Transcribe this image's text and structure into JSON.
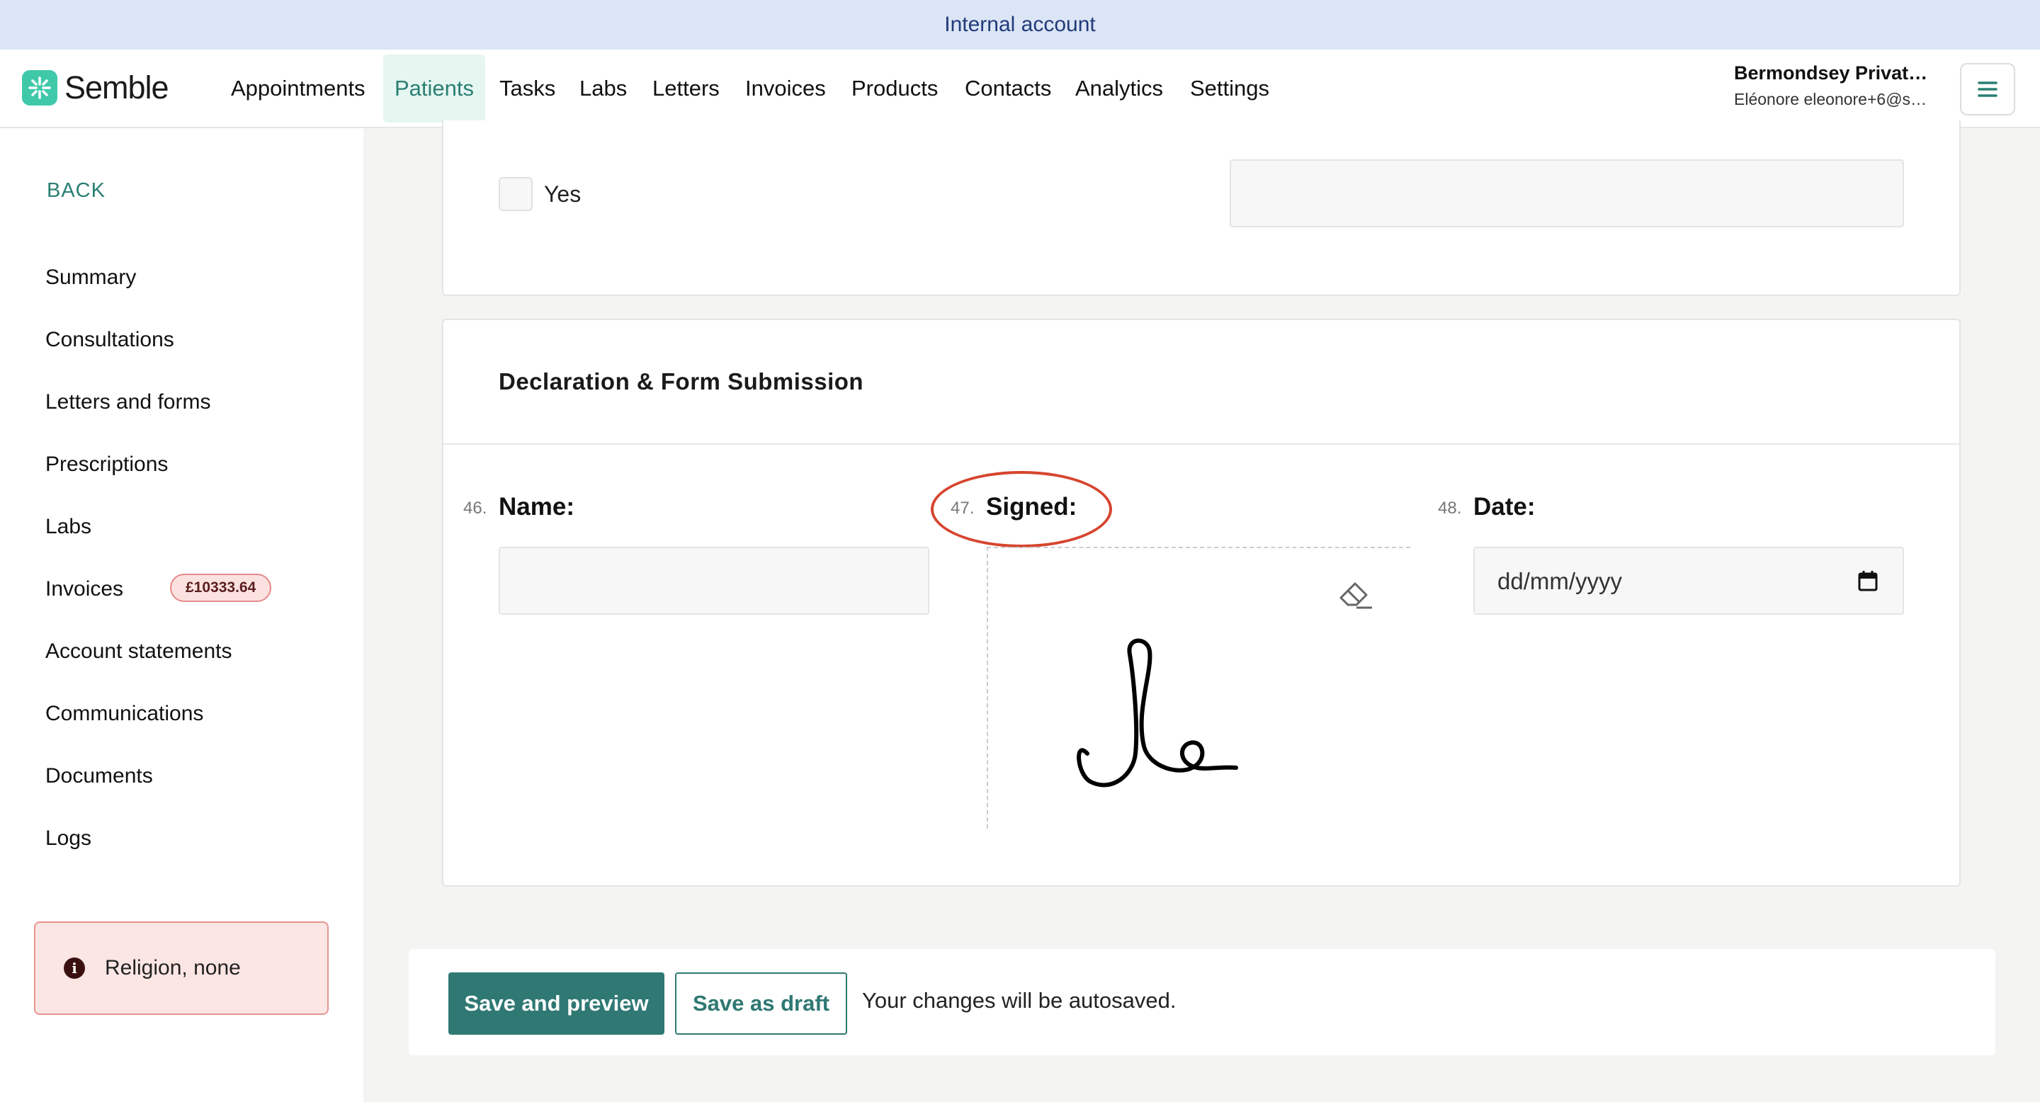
{
  "banner": {
    "text": "Internal account"
  },
  "brand": {
    "name": "Semble",
    "accent": "#3fc9a9"
  },
  "nav": {
    "items": [
      {
        "label": "Appointments",
        "active": false
      },
      {
        "label": "Patients",
        "active": true
      },
      {
        "label": "Tasks",
        "active": false
      },
      {
        "label": "Labs",
        "active": false
      },
      {
        "label": "Letters",
        "active": false
      },
      {
        "label": "Invoices",
        "active": false
      },
      {
        "label": "Products",
        "active": false
      },
      {
        "label": "Contacts",
        "active": false
      },
      {
        "label": "Analytics",
        "active": false
      },
      {
        "label": "Settings",
        "active": false
      }
    ]
  },
  "account": {
    "org": "Bermondsey Private ...",
    "user": "Eléonore eleonore+6@se..."
  },
  "sidebar": {
    "back_label": "BACK",
    "items": [
      {
        "label": "Summary"
      },
      {
        "label": "Consultations"
      },
      {
        "label": "Letters and forms"
      },
      {
        "label": "Prescriptions"
      },
      {
        "label": "Labs"
      },
      {
        "label": "Invoices"
      },
      {
        "label": "Account statements"
      },
      {
        "label": "Communications"
      },
      {
        "label": "Documents"
      },
      {
        "label": "Logs"
      }
    ],
    "invoice_badge": "£10333.64",
    "alert": {
      "icon": "info-icon",
      "text": "Religion, none",
      "color": "#fce6e4"
    }
  },
  "form": {
    "checkbox_label": "Yes",
    "section_title": "Declaration & Form Submission",
    "questions": [
      {
        "number": "46.",
        "label": "Name:"
      },
      {
        "number": "47.",
        "label": "Signed:"
      },
      {
        "number": "48.",
        "label": "Date:"
      }
    ],
    "date_placeholder": "dd/mm/yyyy",
    "highlight_color": "#d6452e"
  },
  "footer": {
    "save_preview": "Save and preview",
    "save_draft": "Save as draft",
    "autosave_text": "Your changes will be autosaved.",
    "primary_color": "#2f7873"
  }
}
